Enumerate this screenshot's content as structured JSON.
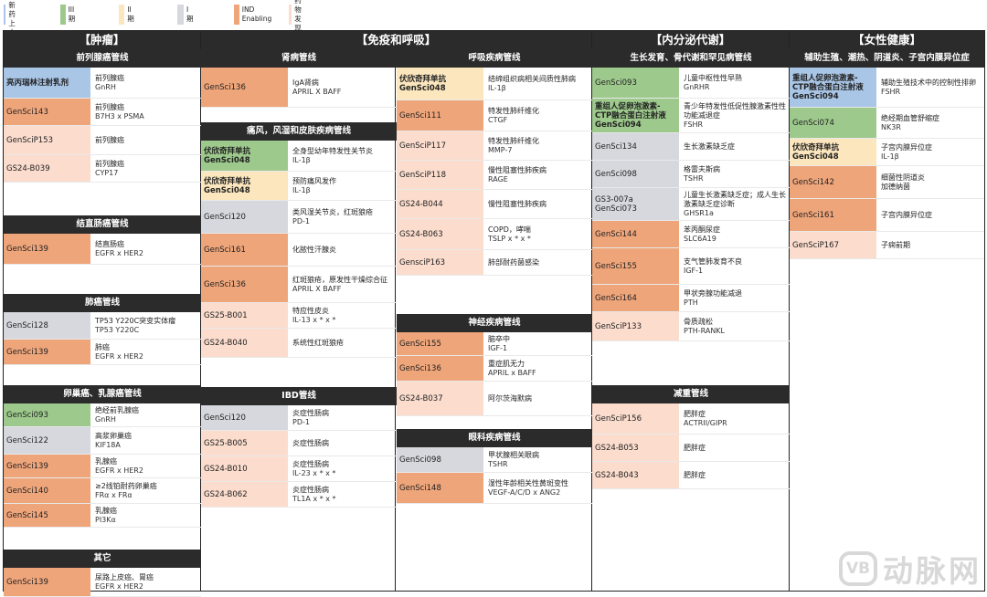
{
  "colors": {
    "approved": "#a9c6e6",
    "phase3": "#9dc98c",
    "phase2": "#fbe6bd",
    "phase1": "#d6d8de",
    "ind": "#efa57a",
    "discovery": "#fbdccd",
    "header": "#2b2b2b"
  },
  "legend": [
    {
      "label": "已递交新药上\n市申请",
      "color": "approved"
    },
    {
      "label": "III期",
      "color": "phase3"
    },
    {
      "label": "II期",
      "color": "phase2"
    },
    {
      "label": "I期",
      "color": "phase1"
    },
    {
      "label": "IND Enabling",
      "color": "ind"
    },
    {
      "label": "药物发现",
      "color": "discovery"
    }
  ],
  "areas": [
    {
      "title": "【肿瘤】"
    },
    {
      "title": "【免疫和呼吸】"
    },
    {
      "title": "【内分泌代谢】"
    },
    {
      "title": "【女性健康】"
    }
  ],
  "sections": [
    {
      "title": "前列腺癌管线",
      "rows": [
        {
          "drug": "亮丙瑞林注射乳剂",
          "bold": true,
          "color": "approved",
          "ind": "前列腺癌",
          "tgt": "GnRH"
        },
        {
          "drug": "GenSci143",
          "color": "ind",
          "ind": "前列腺癌",
          "tgt": "B7H3 x PSMA"
        },
        {
          "drug": "GenSciP153",
          "color": "discovery",
          "ind": "前列腺癌",
          "tgt": ""
        },
        {
          "drug": "GS24-B039",
          "color": "discovery",
          "ind": "前列腺癌",
          "tgt": "CYP17"
        }
      ]
    },
    {
      "title": "结直肠癌管线",
      "rows": [
        {
          "drug": "GenSci139",
          "color": "ind",
          "ind": "结直肠癌",
          "tgt": "EGFR x HER2"
        }
      ]
    },
    {
      "title": "肺癌管线",
      "rows": [
        {
          "drug": "GenSci128",
          "color": "phase1",
          "ind": "TP53 Y220C突变实体瘤",
          "tgt": "TP53 Y220C"
        },
        {
          "drug": "GenSci139",
          "color": "ind",
          "ind": "肺癌",
          "tgt": "EGFR x HER2"
        }
      ]
    },
    {
      "title": "卵巢癌、乳腺癌管线",
      "rows": [
        {
          "drug": "GenSci093",
          "color": "phase3",
          "ind": "绝经前乳腺癌",
          "tgt": "GnRH"
        },
        {
          "drug": "GenSci122",
          "color": "phase1",
          "ind": "高浆卵巢癌",
          "tgt": "KIF18A"
        },
        {
          "drug": "GenSci139",
          "color": "ind",
          "ind": "乳腺癌",
          "tgt": "EGFR x HER2"
        },
        {
          "drug": "GenSci140",
          "color": "ind",
          "ind": "≥2线铂耐药卵巢癌",
          "tgt": "FRα x FRα"
        },
        {
          "drug": "GenSci145",
          "color": "ind",
          "ind": "乳腺癌",
          "tgt": "PI3Kα"
        }
      ]
    },
    {
      "title": "其它",
      "rows": [
        {
          "drug": "GenSci139",
          "color": "ind",
          "ind": "尿路上皮癌、胃癌",
          "tgt": "EGFR x HER2"
        }
      ]
    },
    {
      "title": "肾病管线",
      "rows": [
        {
          "drug": "GenSci136",
          "color": "ind",
          "ind": "IgA肾病",
          "tgt": "APRIL X BAFF"
        }
      ]
    },
    {
      "title": "痛风，风湿和皮肤疾病管线",
      "rows": [
        {
          "drug": "伏欣奇拜单抗\nGenSci048",
          "bold": true,
          "color": "phase3",
          "ind": "全身型幼年特发性关节炎",
          "tgt": "IL-1β"
        },
        {
          "drug": "伏欣奇拜单抗\nGenSci048",
          "bold": true,
          "color": "phase2",
          "ind": "预防痛风发作",
          "tgt": "IL-1β"
        },
        {
          "drug": "GenSci120",
          "color": "phase1",
          "ind": "类风湿关节炎，红斑狼疮",
          "tgt": "PD-1"
        },
        {
          "drug": "GenSci161",
          "color": "ind",
          "ind": "化脓性汗腺炎",
          "tgt": ""
        },
        {
          "drug": "GenSci136",
          "color": "ind",
          "ind": "红斑狼疮，原发性干燥综合征",
          "tgt": "APRIL X BAFF"
        },
        {
          "drug": "GS25-B001",
          "color": "discovery",
          "ind": "特应性皮炎",
          "tgt": "IL-13 x * x *"
        },
        {
          "drug": "GS24-B040",
          "color": "discovery",
          "ind": "系统性红斑狼疮",
          "tgt": ""
        }
      ]
    },
    {
      "title": "IBD管线",
      "rows": [
        {
          "drug": "GenSci120",
          "color": "phase1",
          "ind": "炎症性肠病",
          "tgt": "PD-1"
        },
        {
          "drug": "GS25-B005",
          "color": "discovery",
          "ind": "炎症性肠病",
          "tgt": ""
        },
        {
          "drug": "GS24-B010",
          "color": "discovery",
          "ind": "炎症性肠病",
          "tgt": "IL-23 x * x *"
        },
        {
          "drug": "GS24-B062",
          "color": "discovery",
          "ind": "炎症性肠病",
          "tgt": "TL1A x * x *"
        }
      ]
    },
    {
      "title": "呼吸疾病管线",
      "rows": [
        {
          "drug": "伏欣奇拜单抗\nGenSci048",
          "bold": true,
          "color": "phase2",
          "ind": "结缔组织病相关间质性肺病",
          "tgt": "IL-1β"
        },
        {
          "drug": "GenSci111",
          "color": "ind",
          "ind": "特发性肺纤维化",
          "tgt": "CTGF"
        },
        {
          "drug": "GenSciP117",
          "color": "discovery",
          "ind": "特发性肺纤维化",
          "tgt": "MMP-7"
        },
        {
          "drug": "GenSciP118",
          "color": "discovery",
          "ind": "慢性阻塞性肺疾病",
          "tgt": "RAGE"
        },
        {
          "drug": "GS24-B044",
          "color": "discovery",
          "ind": "慢性阻塞性肺疾病",
          "tgt": ""
        },
        {
          "drug": "GS24-B063",
          "color": "discovery",
          "ind": "COPD，哮喘",
          "tgt": "TSLP x * x *"
        },
        {
          "drug": "GensciP163",
          "color": "discovery",
          "ind": "肺部耐药菌感染",
          "tgt": ""
        }
      ]
    },
    {
      "title": "神经疾病管线",
      "rows": [
        {
          "drug": "GenSci155",
          "color": "ind",
          "ind": "脑卒中",
          "tgt": "IGF-1"
        },
        {
          "drug": "GenSci136",
          "color": "ind",
          "ind": "重症肌无力",
          "tgt": "APRIL x BAFF"
        },
        {
          "drug": "GS24-B037",
          "color": "discovery",
          "ind": "阿尔茨海默病",
          "tgt": ""
        }
      ]
    },
    {
      "title": "眼科疾病管线",
      "rows": [
        {
          "drug": "GenSci098",
          "color": "phase1",
          "ind": "甲状腺相关眼病",
          "tgt": "TSHR"
        },
        {
          "drug": "GenSci148",
          "color": "ind",
          "ind": "湿性年龄相关性黄斑变性",
          "tgt": "VEGF-A/C/D x ANG2"
        }
      ]
    },
    {
      "title": "生长发育、骨代谢和罕见病管线",
      "rows": [
        {
          "drug": "GenSci093",
          "color": "phase3",
          "ind": "儿童中枢性性早熟",
          "tgt": "GnRHR"
        },
        {
          "drug": "重组人促卵泡激素-\nCTP融合蛋白注射液\nGenSci094",
          "bold": true,
          "color": "phase3",
          "ind": "青少年特发性低促性腺激素性性功能减退症",
          "tgt": "FSHR"
        },
        {
          "drug": "GenSci134",
          "color": "phase1",
          "ind": "生长激素缺乏症",
          "tgt": ""
        },
        {
          "drug": "GenSci098",
          "color": "phase1",
          "ind": "格雷夫斯病",
          "tgt": "TSHR"
        },
        {
          "drug": "GS3-007a\nGenSci073",
          "color": "phase1",
          "ind": "儿童生长激素缺乏症；成人生长激素缺乏症诊断",
          "tgt": "GHSR1a"
        },
        {
          "drug": "GenSci144",
          "color": "ind",
          "ind": "苯丙酮尿症",
          "tgt": "SLC6A19"
        },
        {
          "drug": "GenSci155",
          "color": "ind",
          "ind": "支气管肺发育不良",
          "tgt": "IGF-1"
        },
        {
          "drug": "GenSci164",
          "color": "ind",
          "ind": "甲状旁腺功能减退",
          "tgt": "PTH"
        },
        {
          "drug": "GenSciP133",
          "color": "discovery",
          "ind": "骨质疏松",
          "tgt": "PTH-RANKL"
        }
      ]
    },
    {
      "title": "减重管线",
      "rows": [
        {
          "drug": "GenSciP156",
          "color": "discovery",
          "ind": "肥胖症",
          "tgt": "ACTRII/GIPR"
        },
        {
          "drug": "GS24-B053",
          "color": "discovery",
          "ind": "肥胖症",
          "tgt": ""
        },
        {
          "drug": "GS24-B043",
          "color": "discovery",
          "ind": "肥胖症",
          "tgt": ""
        }
      ]
    },
    {
      "title": "辅助生殖、潮热、阴道炎、子宫内膜异位症",
      "rows": [
        {
          "drug": "重组人促卵泡激素-\nCTP融合蛋白注射液\nGenSci094",
          "bold": true,
          "color": "approved",
          "ind": "辅助生殖技术中的控制性排卵",
          "tgt": "FSHR"
        },
        {
          "drug": "GenSci074",
          "color": "phase3",
          "ind": "绝经期血管舒缩症",
          "tgt": "NK3R"
        },
        {
          "drug": "伏欣奇拜单抗\nGenSci048",
          "bold": true,
          "color": "phase2",
          "ind": "子宫内膜异位症",
          "tgt": "IL-1β"
        },
        {
          "drug": "GenSci142",
          "color": "ind",
          "ind": "细菌性阴道炎\n加德纳菌",
          "tgt": ""
        },
        {
          "drug": "GenSci161",
          "color": "ind",
          "ind": "子宫内膜异位症",
          "tgt": ""
        },
        {
          "drug": "GenSciP167",
          "color": "discovery",
          "ind": "子痫前期",
          "tgt": ""
        }
      ]
    }
  ],
  "watermark": {
    "badge": "VB",
    "text": "动脉网"
  }
}
